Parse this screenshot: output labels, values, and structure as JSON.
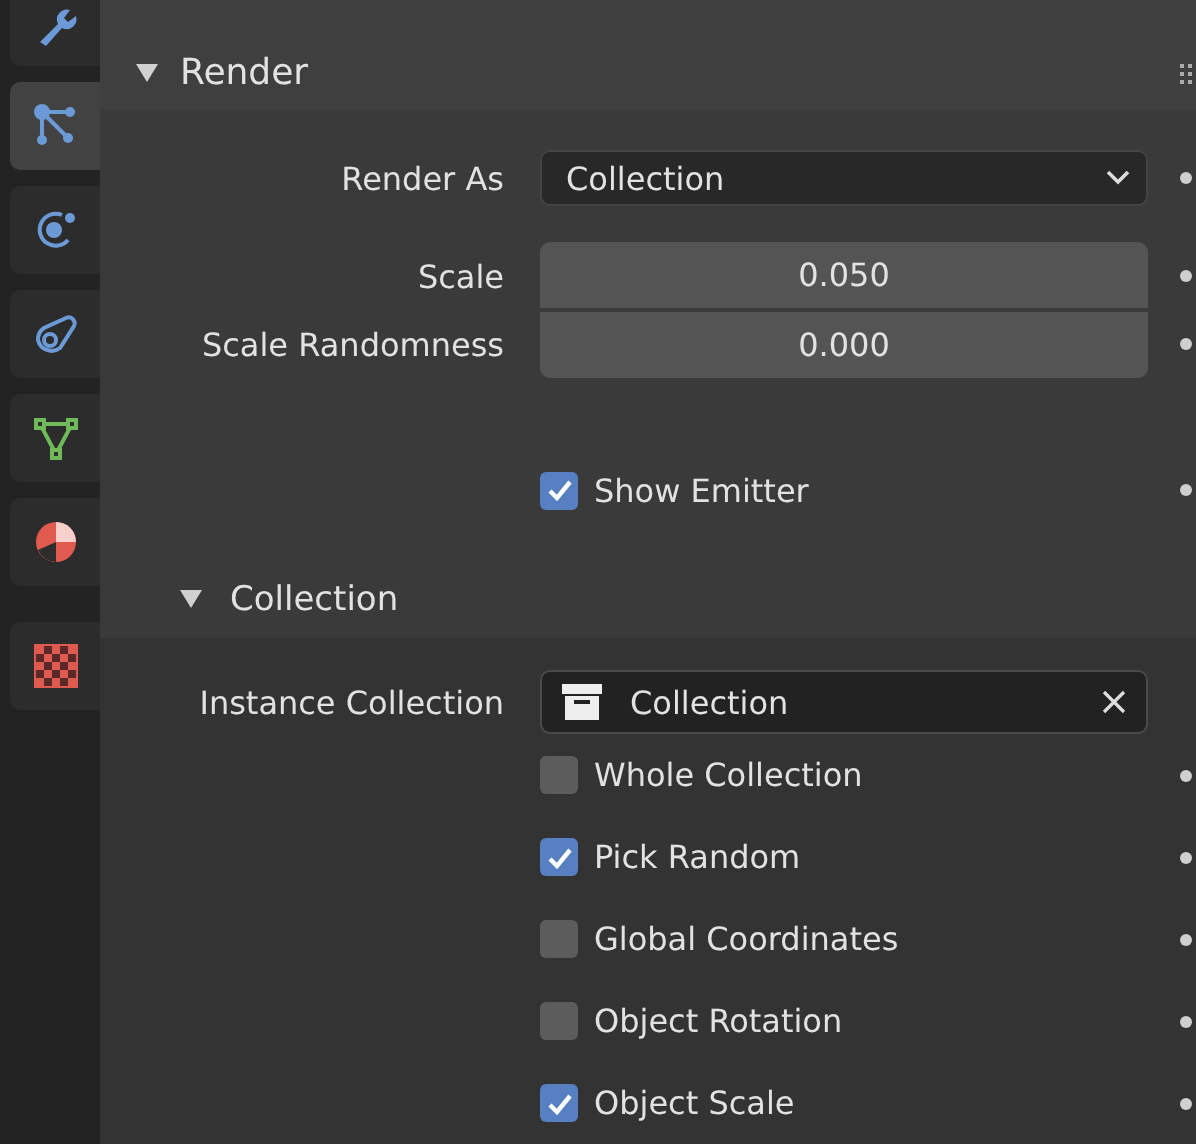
{
  "sidebar": {
    "tabs": [
      {
        "kind": "tool",
        "selected": false
      },
      {
        "kind": "particles",
        "selected": true
      },
      {
        "kind": "physics",
        "selected": false
      },
      {
        "kind": "constraints",
        "selected": false
      },
      {
        "kind": "data",
        "selected": false
      },
      {
        "kind": "material",
        "selected": false
      },
      {
        "kind": "texture",
        "selected": false
      }
    ]
  },
  "render": {
    "title": "Render",
    "expanded": true,
    "render_as": {
      "label": "Render As",
      "value": "Collection"
    },
    "scale": {
      "label": "Scale",
      "value": "0.050"
    },
    "scale_randomness": {
      "label": "Scale Randomness",
      "value": "0.000"
    },
    "show_emitter": {
      "label": "Show Emitter",
      "checked": true
    }
  },
  "collection": {
    "title": "Collection",
    "expanded": true,
    "instance_collection": {
      "label": "Instance Collection",
      "value": "Collection"
    },
    "options": [
      {
        "label": "Whole Collection",
        "checked": false
      },
      {
        "label": "Pick Random",
        "checked": true
      },
      {
        "label": "Global Coordinates",
        "checked": false
      },
      {
        "label": "Object Rotation",
        "checked": false
      },
      {
        "label": "Object Scale",
        "checked": true
      }
    ]
  }
}
